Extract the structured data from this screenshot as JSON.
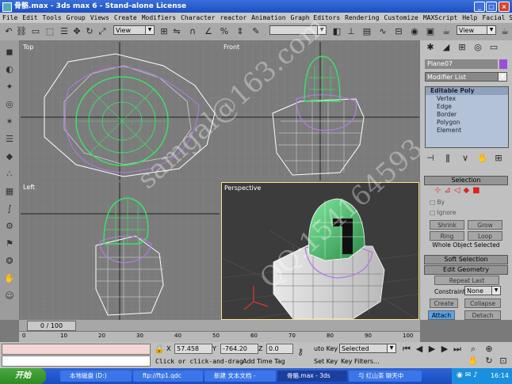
{
  "window": {
    "title": "骨骼.max - 3ds max 6 - Stand-alone License",
    "buttons": {
      "minimize": "_",
      "maximize": "□",
      "close": "×"
    }
  },
  "menu": [
    "File",
    "Edit",
    "Tools",
    "Group",
    "Views",
    "Create",
    "Modifiers",
    "Character",
    "reactor",
    "Animation",
    "Graph Editors",
    "Rendering",
    "Customize",
    "MAXScript",
    "Help",
    "Facial Studio"
  ],
  "toolbar": {
    "view_dropdown": "View",
    "view_dropdown2": "View"
  },
  "viewports": {
    "top": "Top",
    "front": "Front",
    "left": "Left",
    "perspective": "Perspective"
  },
  "panel": {
    "object_name": "Plane07",
    "object_color": "#9b4fd8",
    "modifier_list": "Modifier List",
    "stack": {
      "top": "Editable Poly",
      "items": [
        "Vertex",
        "Edge",
        "Border",
        "Polygon",
        "Element"
      ]
    },
    "selection": {
      "title": "Selection",
      "by_label": "By",
      "ignore_label": "Ignore",
      "shrink": "Shrink",
      "grow": "Grow",
      "ring": "Ring",
      "loop": "Loop",
      "status": "Whole Object Selected"
    },
    "soft_selection": "Soft Selection",
    "edit_geometry": {
      "title": "Edit Geometry",
      "repeat_last": "Repeat Last",
      "constraints_label": "Constraints",
      "constraints_value": "None",
      "create": "Create",
      "collapse": "Collapse",
      "attach": "Attach",
      "detach": "Detach",
      "slice_plane": "Slice Plane",
      "split": "Spli"
    }
  },
  "timeline": {
    "frame": "0 / 100",
    "ruler_ticks": [
      "0",
      "10",
      "20",
      "30",
      "40",
      "50",
      "60",
      "70",
      "80",
      "90",
      "100"
    ]
  },
  "status": {
    "x_label": "X",
    "x": "57.458",
    "y_label": "Y",
    "y": "-764.20",
    "z_label": "Z",
    "z": "0.0",
    "prompt": "Click or click-and-drag",
    "add_time_tag": "Add Time Tag",
    "auto_key": "uto Key",
    "key_mode": "Selected",
    "set_key": "Set Key",
    "key_filters": "Key Filters..."
  },
  "taskbar": {
    "start": "开始",
    "tasks": [
      "本地磁盘 (D:)",
      "ftp://ftp1.qdc",
      "新建 文本文档 -",
      "骨骼.max - 3ds",
      "与 红山茶 聊天中"
    ],
    "clock": "16:14"
  },
  "watermark": [
    "samgal@163.com",
    "QQ:154164593"
  ]
}
